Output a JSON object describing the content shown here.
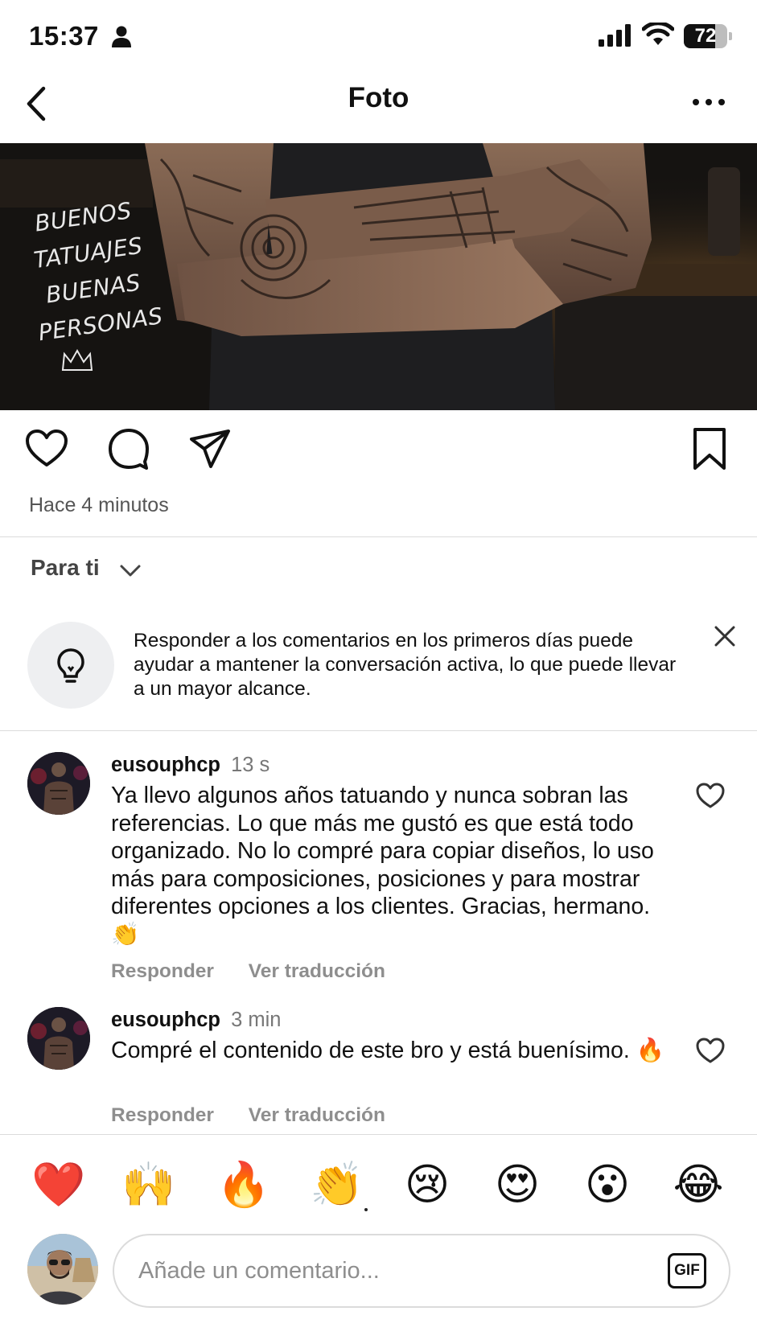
{
  "status_bar": {
    "time": "15:37",
    "battery_percent": 72,
    "battery_label": "72",
    "icons": [
      "person-icon",
      "signal-icon",
      "wifi-icon",
      "battery-icon"
    ]
  },
  "header": {
    "title": "Foto",
    "back_icon": "chevron-left-icon",
    "more_icon": "more-horizontal-icon"
  },
  "post": {
    "image_text": [
      "BUENOS",
      "TATUAJES",
      "BUENAS",
      "PERSONAS"
    ],
    "actions": [
      "heart-icon",
      "comment-icon",
      "share-icon",
      "bookmark-icon"
    ],
    "time_ago": "Hace 4 minutos"
  },
  "sort": {
    "label": "Para ti"
  },
  "tip": {
    "text": "Responder a los comentarios en los primeros días puede ayudar a mantener la conversación activa, lo que puede llevar a un mayor alcance."
  },
  "comments": [
    {
      "username": "eusouphcp",
      "time": "13 s",
      "text": "Ya llevo algunos años tatuando y nunca sobran las referencias. Lo que más me gustó es que está todo organizado. No lo compré para copiar diseños, lo uso más para composiciones, posiciones y para mostrar diferentes opciones a los clientes. Gracias, hermano. 👏",
      "reply_label": "Responder",
      "translate_label": "Ver traducción"
    },
    {
      "username": "eusouphcp",
      "time": "3 min",
      "text": "Compré el contenido de este bro y está buenísimo. 🔥",
      "reply_label": "Responder",
      "translate_label": "Ver traducción"
    }
  ],
  "quick_reactions": [
    "❤️",
    "🙌",
    "🔥",
    "👏",
    "😢",
    "😍",
    "😮",
    "😂"
  ],
  "composer": {
    "placeholder": "Añade un comentario...",
    "value": "",
    "gif_label": "GIF"
  },
  "colors": {
    "primary_text": "#111111",
    "secondary_text": "#8e8e8e",
    "divider": "#dbdbdb",
    "tip_bg": "#eeeff1"
  }
}
